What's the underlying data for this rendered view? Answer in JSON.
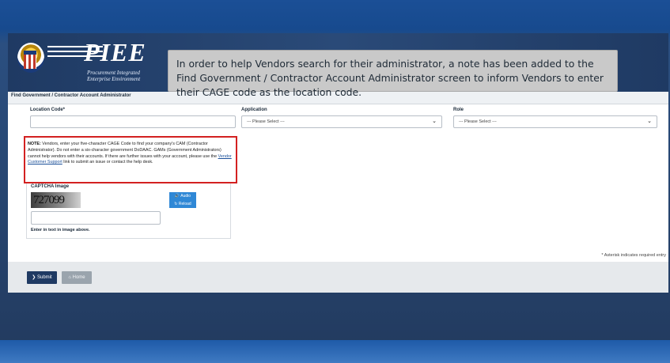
{
  "header": {
    "logo_title": "PIEE",
    "logo_subtitle_1": "Procurement Integrated",
    "logo_subtitle_2": "Enterprise Environment"
  },
  "callout": {
    "text": "In order to help Vendors search for their administrator, a note has been added to the Find Government / Contractor Account Administrator screen to inform Vendors to enter their CAGE code as the location code."
  },
  "page": {
    "title": "Find Government / Contractor Account Administrator"
  },
  "form": {
    "location_label": "Location Code*",
    "location_value": "",
    "application_label": "Application",
    "application_selected": "--- Please Select ---",
    "role_label": "Role",
    "role_selected": "--- Please Select ---"
  },
  "note": {
    "prefix": "NOTE:",
    "text_1": " Vendors, enter your five-character CAGE Code to find your company's CAM (Contractor Administrator). Do not enter a six-character government DoDAAC. GAMs (Government Administrators) cannot help vendors with their accounts. If there are further issues with your account, please use the ",
    "link": "Vendor Customer Support",
    "text_2": " link to submit an issue or contact the help desk."
  },
  "captcha": {
    "label": "CAPTCHA Image",
    "image_text": "727099",
    "audio_label": "Audio",
    "reload_label": "Reload",
    "input_value": "",
    "hint": "Enter in text in image above."
  },
  "required_note": "* Asterisk indicates required entry",
  "buttons": {
    "submit": "Submit",
    "home": "Home"
  },
  "colors": {
    "header_bg": "#1f3a63",
    "note_border": "#d32121",
    "submit_bg": "#1f3a63",
    "captcha_btn": "#2f88d6"
  }
}
